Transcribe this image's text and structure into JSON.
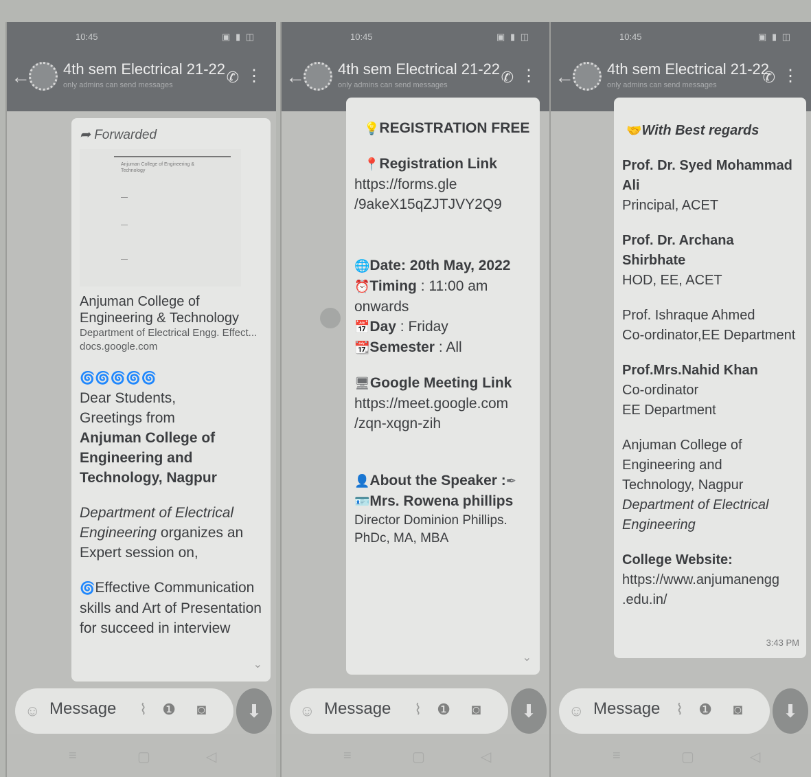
{
  "common": {
    "status_time": "10:45",
    "status_icons": "▣ ▮ ◫",
    "group_title": "4th sem Electrical 21-22",
    "group_subtitle": "only admins can send messages",
    "message_placeholder": "Message",
    "back_glyph": "←",
    "call_glyph": "✆",
    "kebab_glyph": "⋮",
    "smiley_glyph": "☺",
    "attach_glyph": "⌇",
    "pay_glyph": "❶",
    "camera_glyph": "◙",
    "mic_glyph": "⬇",
    "nav_recent": "≡",
    "nav_home": "▢",
    "nav_back": "◁"
  },
  "screen1": {
    "forwarded": "Forwarded",
    "doc_preview_title": "Anjuman College of Engineering & Technology",
    "doc_title": "Anjuman College of Engineering & Technology",
    "doc_desc": "Department of Electrical Engg. Effect...",
    "doc_domain": "docs.google.com",
    "emoji_row": "🌀🌀🌀🌀🌀",
    "line1": "Dear Students,",
    "line2": "Greetings from",
    "college_bold": "Anjuman College of Engineering and Technology, Nagpur",
    "dept_italic": "Department of Electrical Engineering",
    "organizes": " organizes an Expert session on,",
    "topic": "Effective Communication skills and Art of Presentation for succeed in interview"
  },
  "screen2": {
    "registration_free": "REGISTRATION FREE",
    "registration_link_label": "Registration Link",
    "registration_url": "https://forms.gle /9akeX15qZJTJVY2Q9",
    "date": "Date: 20th May, 2022",
    "timing_label": "Timing",
    "timing_value": " : 11:00 am onwards",
    "day_label": "Day",
    "day_value": " : Friday",
    "semester_label": "Semester",
    "semester_value": " : All",
    "meet_label": "Google Meeting Link",
    "meet_url": "https://meet.google.com /zqn-xqgn-zih",
    "about_speaker": "About the Speaker :",
    "speaker_name": "Mrs. Rowena phillips",
    "speaker_role": "Director Dominion Phillips. PhDc, MA, MBA",
    "cal_day": "24"
  },
  "screen3": {
    "regards": "With Best regards",
    "p1_name": "Prof. Dr. Syed Mohammad Ali",
    "p1_role": "Principal, ACET",
    "p2_name": "Prof. Dr. Archana Shirbhate",
    "p2_role": "HOD, EE, ACET",
    "p3_name": "Prof. Ishraque Ahmed",
    "p3_role": "Co-ordinator,EE Department",
    "p4_name": "Prof.Mrs.Nahid Khan",
    "p4_role1": "Co-ordinator",
    "p4_role2": "EE Department",
    "college": "Anjuman College of Engineering and Technology, Nagpur",
    "dept": "Department of Electrical Engineering",
    "website_label": "College Website:",
    "website_url": "https://www.anjumanengg .edu.in/",
    "time": "3:43 PM"
  }
}
